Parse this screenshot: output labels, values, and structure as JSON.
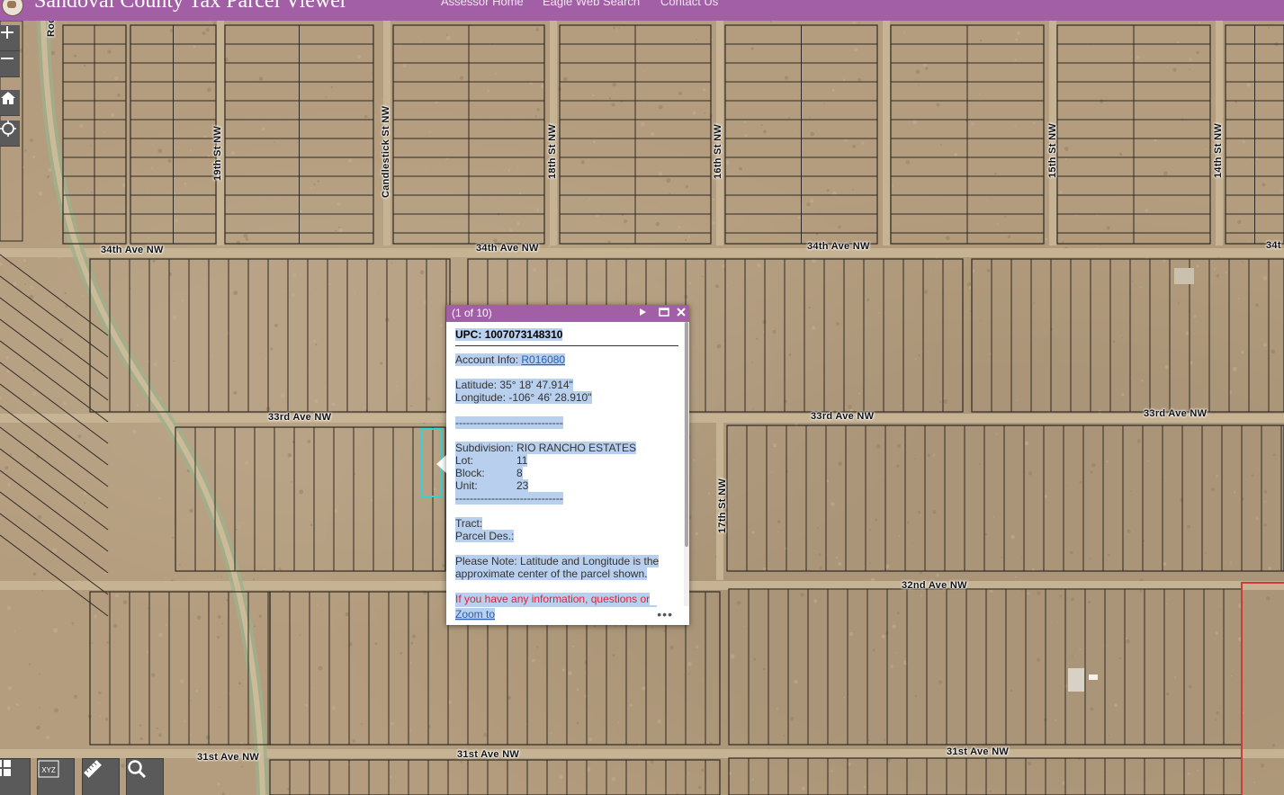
{
  "header": {
    "title": "Sandoval County Tax Parcel Viewer",
    "nav": [
      "Assessor Home",
      "Eagle Web Search",
      "Contact Us"
    ]
  },
  "map": {
    "road_labels": {
      "ave_34_left": "34th Ave NW",
      "ave_34_mid": "34th Ave NW",
      "ave_34_right": "34th Ave NW",
      "ave_34_edge": "34t",
      "ave_33_left": "33rd Ave NW",
      "ave_33_mid": "33rd Ave NW",
      "ave_33_right": "33rd Ave NW",
      "ave_32_right": "32nd Ave NW",
      "ave_31_left": "31st Ave NW",
      "ave_31_mid": "31st Ave NW",
      "ave_31_right": "31st Ave NW",
      "st_19": "19th St NW",
      "st_candlestick": "Candlestick St NW",
      "st_18": "18th St NW",
      "st_16": "16th St NW",
      "st_15": "15th St NW",
      "st_14": "14th St NW",
      "st_17": "17th St NW",
      "st_top_left": "Roc"
    },
    "icons": {
      "zoom_in": "plus-icon",
      "zoom_out": "minus-icon",
      "home": "home-icon",
      "locate": "locate-icon",
      "basemap": "grid-icon",
      "coords": "xyz-icon",
      "measure": "ruler-icon",
      "search": "search-icon"
    },
    "colors": {
      "selection": "#33d4d4",
      "header": "#a35fa6",
      "boundary": "#d23a3a"
    }
  },
  "popup": {
    "count": "(1 of 10)",
    "upc_label": "UPC:",
    "upc": "1007073148310",
    "account_label": "Account Info:",
    "account": "R016080",
    "latitude_label": "Latitude:",
    "latitude": "35° 18' 47.914\"",
    "longitude_label": "Longitude:",
    "longitude": "-106° 46' 28.910\"",
    "separator": "------------------------------",
    "subdivision_label": "Subdivision:",
    "subdivision": "RIO RANCHO ESTATES",
    "lot_label": "Lot:",
    "lot": "11",
    "block_label": "Block:",
    "block": "8",
    "unit_label": "Unit:",
    "unit": "23",
    "tract_label": "Tract:",
    "parcel_des_label": "Parcel Des.:",
    "note": "Please Note: Latitude and Longitude is the approximate center of the parcel shown.",
    "contact_note": "If you have any information, questions or concerns about this parcel, please contact",
    "zoom_to": "Zoom to",
    "more": "•••"
  }
}
